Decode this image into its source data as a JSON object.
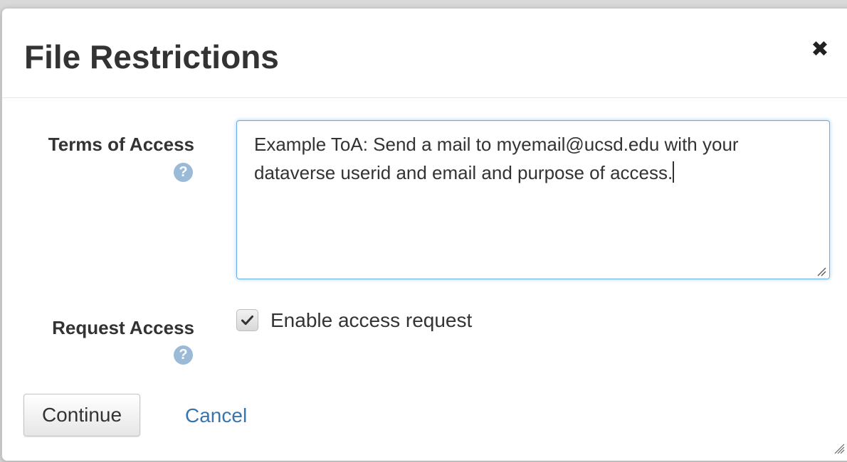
{
  "dialog": {
    "title": "File Restrictions",
    "close_icon": "close-icon"
  },
  "terms_of_access": {
    "label": "Terms of Access",
    "help_icon": "help-icon",
    "value": "Example ToA: Send a mail to myemail@ucsd.edu with your\ndataverse userid and email and purpose of access."
  },
  "request_access": {
    "label": "Request Access",
    "help_icon": "help-icon",
    "checkbox_label": "Enable access request",
    "checked": true
  },
  "actions": {
    "continue_label": "Continue",
    "cancel_label": "Cancel"
  },
  "colors": {
    "link": "#3775b0",
    "help_icon": "#9bbad8",
    "focus_border": "#66afe9"
  }
}
